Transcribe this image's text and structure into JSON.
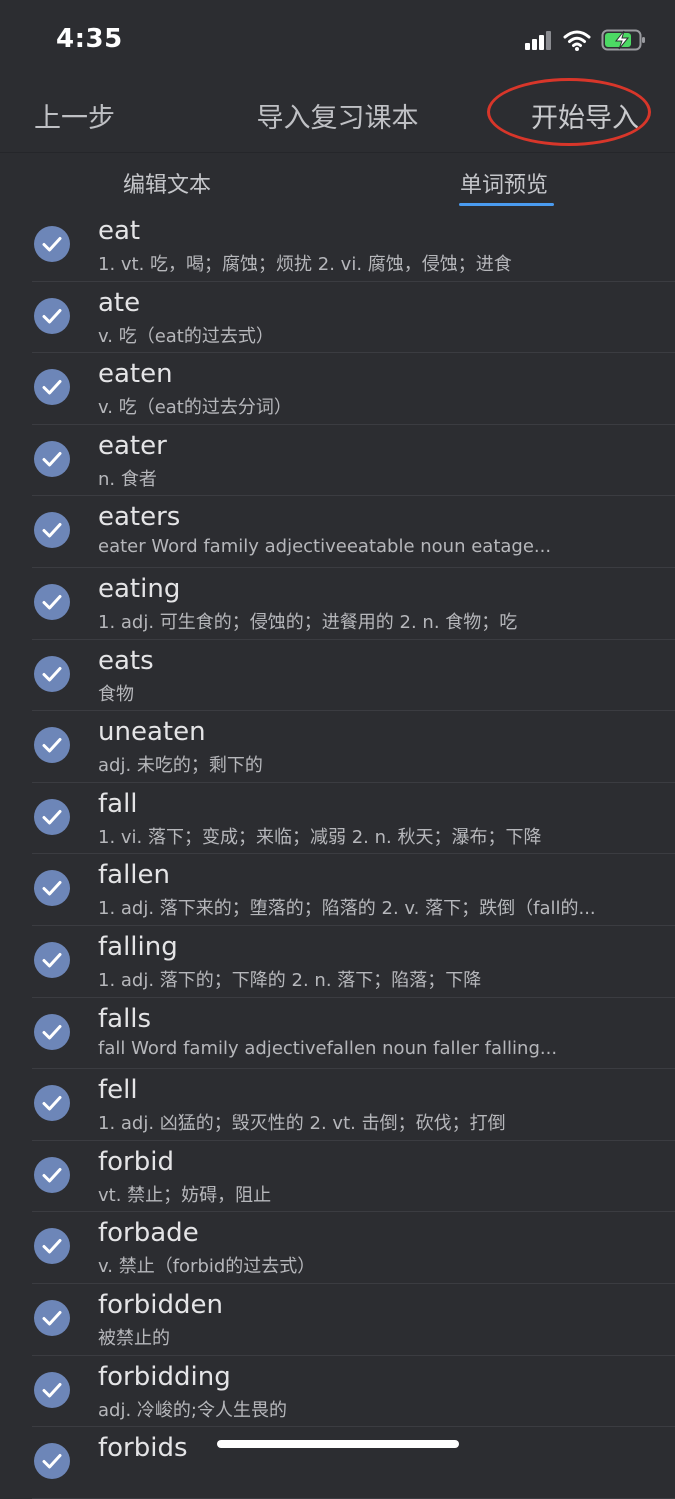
{
  "status": {
    "time": "4:35"
  },
  "nav": {
    "back_label": "上一步",
    "title": "导入复习课本",
    "action_label": "开始导入"
  },
  "tabs": [
    {
      "label": "编辑文本"
    },
    {
      "label": "单词预览"
    }
  ],
  "colors": {
    "accent": "#4a9bf0",
    "check": "#6d86b8",
    "annotation": "#d8362a",
    "background": "#2c2d31"
  },
  "words": [
    {
      "word": "eat",
      "definition": "1. vt. 吃，喝；腐蚀；烦扰 2. vi. 腐蚀，侵蚀；进食"
    },
    {
      "word": "ate",
      "definition": "v. 吃（eat的过去式）"
    },
    {
      "word": "eaten",
      "definition": "v. 吃（eat的过去分词）"
    },
    {
      "word": "eater",
      "definition": "n. 食者"
    },
    {
      "word": "eaters",
      "definition": "eater  Word family          adjectiveeatable  noun  eatage..."
    },
    {
      "word": "eating",
      "definition": "1. adj. 可生食的；侵蚀的；进餐用的 2. n. 食物；吃"
    },
    {
      "word": "eats",
      "definition": "食物"
    },
    {
      "word": "uneaten",
      "definition": "adj. 未吃的；剩下的"
    },
    {
      "word": "fall",
      "definition": "1. vi. 落下；变成；来临；减弱 2. n. 秋天；瀑布；下降"
    },
    {
      "word": "fallen",
      "definition": "1. adj. 落下来的；堕落的；陷落的 2. v. 落下；跌倒（fall的..."
    },
    {
      "word": "falling",
      "definition": "1. adj. 落下的；下降的 2. n. 落下；陷落；下降"
    },
    {
      "word": "falls",
      "definition": "fall  Word family          adjectivefallen  noun  faller  falling..."
    },
    {
      "word": "fell",
      "definition": "1. adj. 凶猛的；毁灭性的 2. vt. 击倒；砍伐；打倒"
    },
    {
      "word": "forbid",
      "definition": "vt. 禁止；妨碍，阻止"
    },
    {
      "word": "forbade",
      "definition": "v. 禁止（forbid的过去式）"
    },
    {
      "word": "forbidden",
      "definition": "被禁止的"
    },
    {
      "word": "forbidding",
      "definition": "adj. 冷峻的;令人生畏的"
    },
    {
      "word": "forbids",
      "definition": ""
    }
  ]
}
